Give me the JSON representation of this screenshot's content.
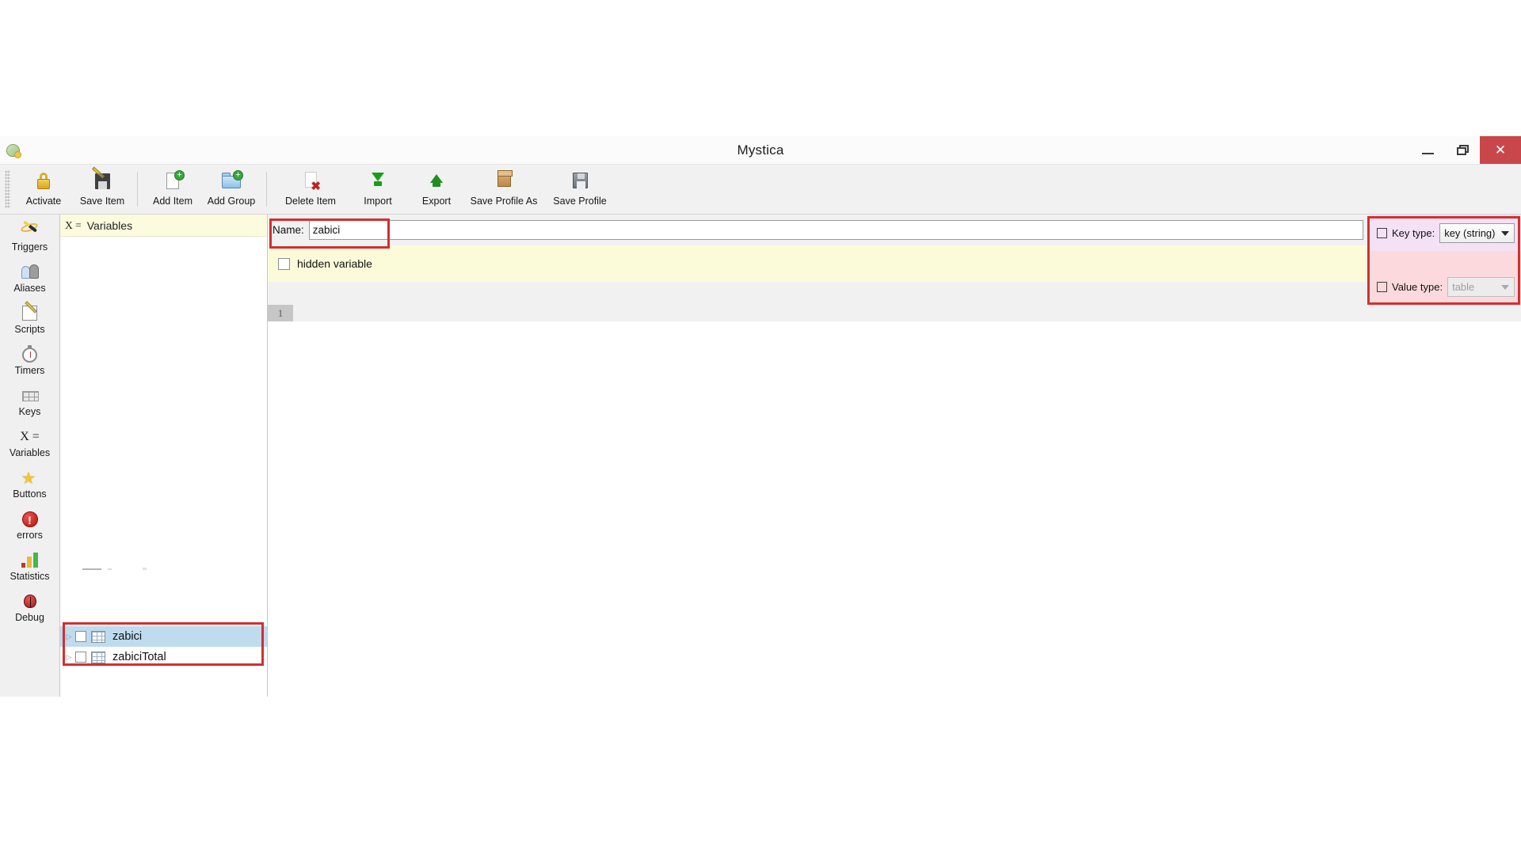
{
  "window": {
    "title": "Mystica",
    "logo_icon": "mystica-logo-icon",
    "minimize_label": "Minimize",
    "maximize_label": "Restore",
    "close_label": "Close"
  },
  "toolbar": {
    "buttons": [
      {
        "label": "Activate",
        "icon": "lock-icon"
      },
      {
        "label": "Save Item",
        "icon": "save-item-icon"
      },
      {
        "label": "Add Item",
        "icon": "add-item-icon"
      },
      {
        "label": "Add Group",
        "icon": "add-group-icon"
      },
      {
        "label": "Delete Item",
        "icon": "delete-item-icon"
      },
      {
        "label": "Import",
        "icon": "import-arrow-down-icon"
      },
      {
        "label": "Export",
        "icon": "export-arrow-up-icon"
      },
      {
        "label": "Save Profile As",
        "icon": "package-box-icon"
      },
      {
        "label": "Save Profile",
        "icon": "floppy-disk-icon"
      }
    ]
  },
  "sidebar": {
    "items": [
      {
        "label": "Triggers",
        "icon": "magic-wand-icon"
      },
      {
        "label": "Aliases",
        "icon": "people-icon"
      },
      {
        "label": "Scripts",
        "icon": "notepad-pencil-icon"
      },
      {
        "label": "Timers",
        "icon": "stopwatch-icon"
      },
      {
        "label": "Keys",
        "icon": "keyboard-icon"
      },
      {
        "label": "Variables",
        "icon": "x-equals-icon"
      },
      {
        "label": "Buttons",
        "icon": "star-icon"
      },
      {
        "label": "errors",
        "icon": "error-circle-icon"
      },
      {
        "label": "Statistics",
        "icon": "bar-chart-icon"
      },
      {
        "label": "Debug",
        "icon": "ladybug-icon"
      }
    ]
  },
  "tree": {
    "header": {
      "prefix": "X =",
      "title": "Variables"
    },
    "rows": [
      {
        "label": "zabici",
        "expander": "▷",
        "checked": false,
        "icon": "table-icon",
        "selected": true
      },
      {
        "label": "zabiciTotal",
        "expander": "▷",
        "checked": false,
        "icon": "table-icon",
        "selected": false
      }
    ]
  },
  "editor": {
    "name_label": "Name:",
    "name_value": "zabici",
    "hidden_variable_label": "hidden variable",
    "hidden_variable_checked": false,
    "line_number": "1",
    "content": ""
  },
  "types": {
    "key_type_label": "Key type:",
    "key_type_value": "key (string)",
    "key_type_checked": false,
    "key_type_enabled": true,
    "value_type_label": "Value type:",
    "value_type_value": "table",
    "value_type_checked": false,
    "value_type_enabled": false
  },
  "annotations": {
    "color": "#d32f2f",
    "boxes": [
      "name-field",
      "tree-variable-rows",
      "type-selectors"
    ]
  }
}
